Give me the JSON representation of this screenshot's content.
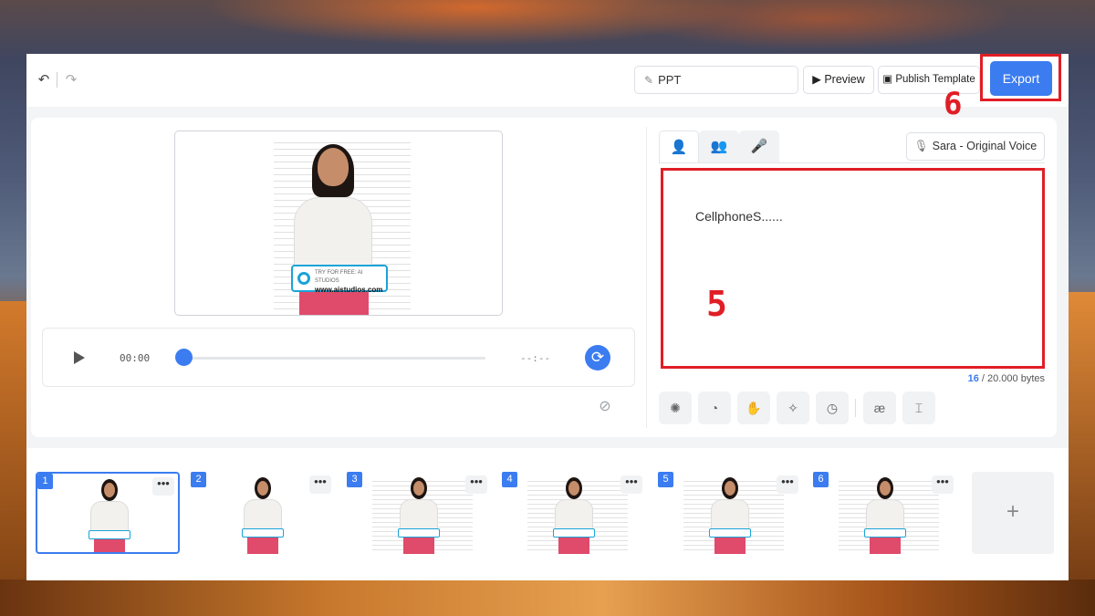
{
  "toolbar": {
    "undo_icon": "undo-icon",
    "redo_icon": "redo-icon",
    "title_value": "PPT",
    "preview_label": "Preview",
    "publish_label": "Publish Template",
    "export_label": "Export"
  },
  "annotations": {
    "export_step": "6",
    "script_step": "5"
  },
  "player": {
    "current_time": "00:00",
    "end_time": "--:--",
    "progress": 0
  },
  "voice": {
    "tabs": [
      "avatar-tab",
      "group-tab",
      "mic-tab"
    ],
    "selected_voice": "Sara - Original Voice"
  },
  "script": {
    "text": "CellphoneS......",
    "bytes_used": "16",
    "bytes_limit": "/ 20.000 bytes"
  },
  "preview_watermark": {
    "tagline": "TRY FOR FREE: AI STUDIOS",
    "url": "www.aistudios.com"
  },
  "slides": [
    {
      "number": "1",
      "selected": true
    },
    {
      "number": "2",
      "selected": false
    },
    {
      "number": "3",
      "selected": false
    },
    {
      "number": "4",
      "selected": false
    },
    {
      "number": "5",
      "selected": false
    },
    {
      "number": "6",
      "selected": false
    }
  ],
  "slide_more_label": "•••",
  "add_slide_label": "+",
  "colors": {
    "accent": "#3b7cf0",
    "annotation": "#e01e26"
  }
}
